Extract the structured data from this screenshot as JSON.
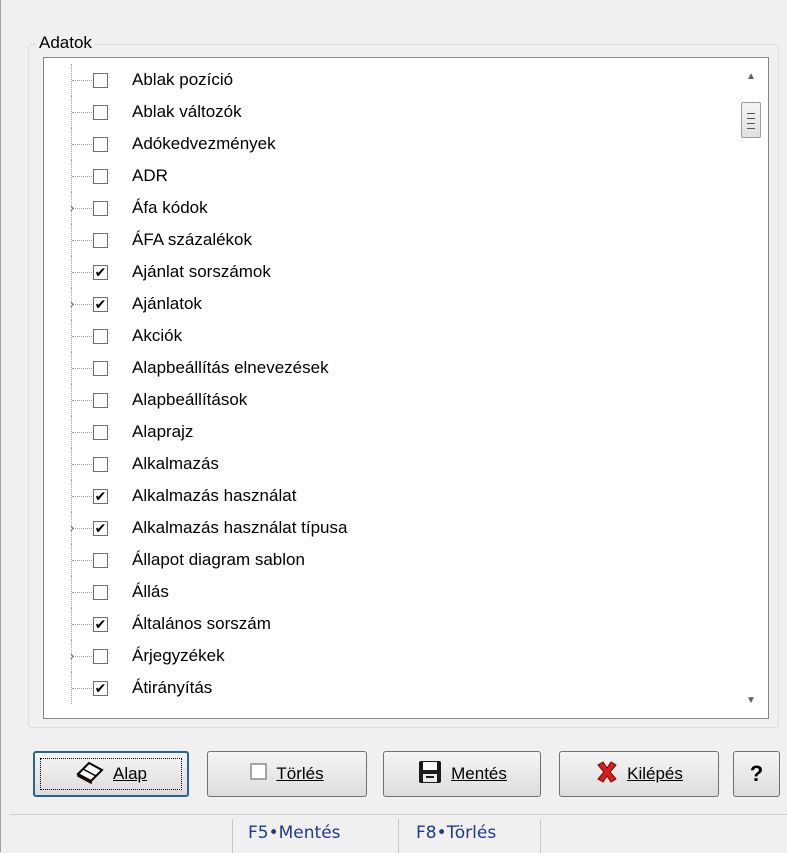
{
  "group": {
    "title": "Adatok"
  },
  "tree": {
    "items": [
      {
        "label": "Ablak pozíció",
        "checked": false,
        "expandable": false
      },
      {
        "label": "Ablak változók",
        "checked": false,
        "expandable": false
      },
      {
        "label": "Adókedvezmények",
        "checked": false,
        "expandable": false
      },
      {
        "label": "ADR",
        "checked": false,
        "expandable": false
      },
      {
        "label": "Áfa kódok",
        "checked": false,
        "expandable": true
      },
      {
        "label": "ÁFA százalékok",
        "checked": false,
        "expandable": false
      },
      {
        "label": "Ajánlat sorszámok",
        "checked": true,
        "expandable": false
      },
      {
        "label": "Ajánlatok",
        "checked": true,
        "expandable": true
      },
      {
        "label": "Akciók",
        "checked": false,
        "expandable": false
      },
      {
        "label": "Alapbeállítás elnevezések",
        "checked": false,
        "expandable": false
      },
      {
        "label": "Alapbeállítások",
        "checked": false,
        "expandable": false
      },
      {
        "label": "Alaprajz",
        "checked": false,
        "expandable": false
      },
      {
        "label": "Alkalmazás",
        "checked": false,
        "expandable": false
      },
      {
        "label": "Alkalmazás használat",
        "checked": true,
        "expandable": false
      },
      {
        "label": "Alkalmazás használat típusa",
        "checked": true,
        "expandable": true
      },
      {
        "label": "Állapot diagram sablon",
        "checked": false,
        "expandable": false
      },
      {
        "label": "Állás",
        "checked": false,
        "expandable": false
      },
      {
        "label": "Általános sorszám",
        "checked": true,
        "expandable": false
      },
      {
        "label": "Árjegyzékek",
        "checked": false,
        "expandable": true
      },
      {
        "label": "Átirányítás",
        "checked": true,
        "expandable": false
      }
    ]
  },
  "buttons": {
    "alap": {
      "label": "Alap",
      "icon": "eraser-icon"
    },
    "torles": {
      "label": "Törlés",
      "icon": "checkbox-icon"
    },
    "mentes": {
      "label": "Mentés",
      "icon": "floppy-disk-icon"
    },
    "kilepes": {
      "label": "Kilépés",
      "icon": "red-x-icon"
    },
    "help": {
      "label": "?"
    }
  },
  "statusbar": {
    "save_hint": "F5•Mentés",
    "delete_hint": "F8•Törlés"
  },
  "colors": {
    "exit_icon": "#d62020",
    "floppy": "#1a1a1a",
    "status_text": "#1f3a8a"
  }
}
